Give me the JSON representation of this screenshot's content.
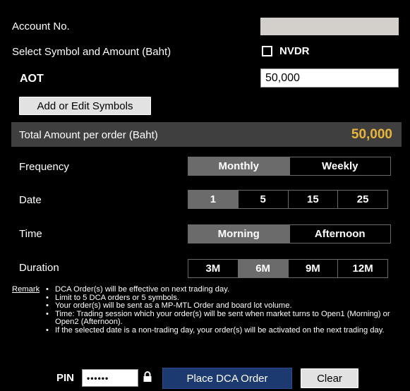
{
  "account": {
    "label": "Account No.",
    "value": ""
  },
  "symbol_section": {
    "label": "Select Symbol and Amount (Baht)",
    "nvdr_label": "NVDR",
    "nvdr_checked": false
  },
  "symbol": {
    "name": "AOT",
    "amount": "50,000"
  },
  "add_edit_label": "Add or Edit Symbols",
  "total": {
    "label": "Total Amount per order (Baht)",
    "value": "50,000",
    "value_color": "#e8b53a"
  },
  "frequency": {
    "label": "Frequency",
    "options": [
      "Monthly",
      "Weekly"
    ],
    "selected": "Monthly"
  },
  "date": {
    "label": "Date",
    "options": [
      "1",
      "5",
      "15",
      "25"
    ],
    "selected": "1"
  },
  "time": {
    "label": "Time",
    "options": [
      "Morning",
      "Afternoon"
    ],
    "selected": "Morning"
  },
  "duration": {
    "label": "Duration",
    "options": [
      "3M",
      "6M",
      "9M",
      "12M"
    ],
    "selected": "6M"
  },
  "remark": {
    "label": "Remark",
    "items": [
      "DCA Order(s) will be effective on next trading day.",
      "Limit to 5 DCA orders or 5 symbols.",
      "Your order(s) will be sent as a MP-MTL Order and board lot volume.",
      "Time: Trading session which your order(s) will be sent when market turns to Open1 (Morning) or Open2 (Afternoon).",
      "If the selected date is a non-trading day, your order(s) will be activated on the next trading day."
    ]
  },
  "pin": {
    "label": "PIN",
    "value": "••••••",
    "lock_icon": "lock-icon"
  },
  "place_label": "Place DCA Order",
  "clear_label": "Clear",
  "colors": {
    "panel": "#3f3f3f",
    "active": "#6b6b6b",
    "place_button": "#1c3a70",
    "accent": "#e8b53a"
  }
}
